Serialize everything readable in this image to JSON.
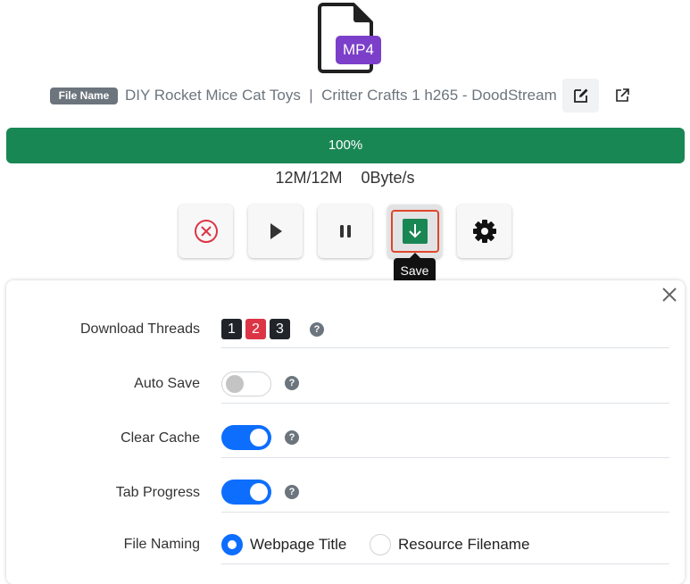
{
  "file": {
    "type_badge": "MP4",
    "name_badge": "File Name",
    "name": "DIY Rocket Mice Cat Toys  |  Critter Crafts 1 h265 - DoodStream"
  },
  "progress": {
    "value": 1.0,
    "label": "100%",
    "downloaded": "12M/12M",
    "speed": "0Byte/s"
  },
  "controls": {
    "cancel_icon": "circle-x-icon",
    "play_icon": "play-icon",
    "pause_icon": "pause-icon",
    "save_icon": "download-icon",
    "settings_icon": "gear-icon",
    "save_tooltip": "Save"
  },
  "settings": {
    "download_threads": {
      "label": "Download Threads",
      "options": [
        "1",
        "2",
        "3"
      ],
      "selected": "2"
    },
    "auto_save": {
      "label": "Auto Save",
      "enabled": false
    },
    "clear_cache": {
      "label": "Clear Cache",
      "enabled": true
    },
    "tab_progress": {
      "label": "Tab Progress",
      "enabled": true
    },
    "file_naming": {
      "label": "File Naming",
      "options": [
        "Webpage Title",
        "Resource Filename"
      ],
      "selected": "Webpage Title"
    },
    "help_glyph": "?"
  },
  "colors": {
    "progress": "#198754",
    "badge_purple": "#7b3fc9",
    "toggle_on": "#0d6efd",
    "save_button": "#198754",
    "save_highlight": "#e0462a",
    "thread_active": "#dc3545"
  }
}
